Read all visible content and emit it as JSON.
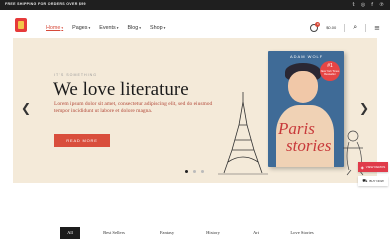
{
  "topbar": {
    "promo": "FREE SHIPPING FOR ORDERS OVER $99",
    "social": [
      "t",
      "ig",
      "f",
      "p"
    ]
  },
  "nav": {
    "items": [
      {
        "label": "Home",
        "active": true
      },
      {
        "label": "Pages",
        "active": false
      },
      {
        "label": "Events",
        "active": false
      },
      {
        "label": "Blog",
        "active": false
      },
      {
        "label": "Shop",
        "active": false
      }
    ]
  },
  "header": {
    "cart_count": "0",
    "cart_total": "$0.00"
  },
  "hero": {
    "eyebrow": "IT'S SOMETHING",
    "headline": "We love literature",
    "lead": "Lorem ipsum dolor sit amet, consectetur adipiscing elit, sed do eiusmod tempor incididunt ut labore et dolore magna.",
    "cta": "READ MORE",
    "book": {
      "author": "ADAM WOLF",
      "title_line1": "Paris",
      "title_line2": "stories",
      "sticker_number": "#1",
      "sticker_text": "New York Times Bestseller"
    },
    "slide_index": 1,
    "slide_count": 3
  },
  "floating": {
    "demos": "VIEW DEMOS",
    "buy": "BUY NOW"
  },
  "categories": [
    {
      "label": "All",
      "active": true
    },
    {
      "label": "Best Sellers",
      "active": false
    },
    {
      "label": "Fantasy",
      "active": false
    },
    {
      "label": "History",
      "active": false
    },
    {
      "label": "Art",
      "active": false
    },
    {
      "label": "Love Stories",
      "active": false
    }
  ],
  "colors": {
    "accent": "#d94e3c",
    "hero_bg": "#f4ead9",
    "dark": "#1f1f1f"
  }
}
